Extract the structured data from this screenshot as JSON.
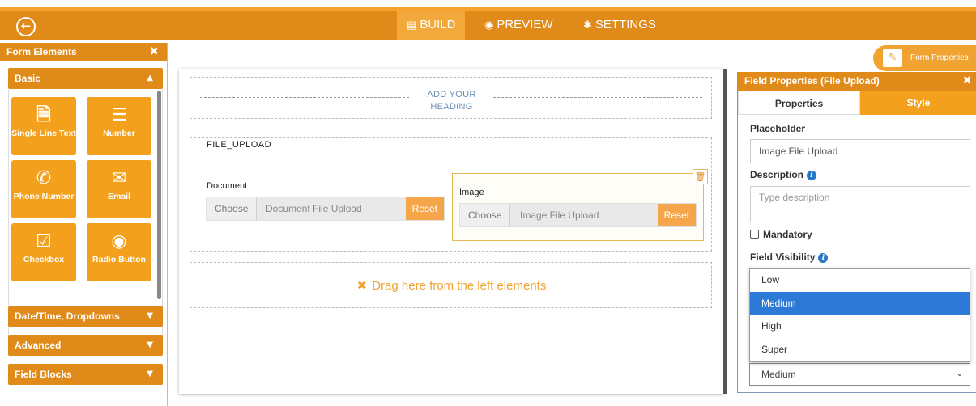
{
  "topbar": {
    "back_icon": "arrow-left-circle-icon",
    "tabs": [
      {
        "label": "BUILD",
        "icon": "form-icon",
        "active": true
      },
      {
        "label": "PREVIEW",
        "icon": "eye-icon",
        "active": false
      },
      {
        "label": "SETTINGS",
        "icon": "gear-icon",
        "active": false
      }
    ]
  },
  "left_panel": {
    "title": "Form Elements",
    "sections": {
      "basic": "Basic",
      "datetime": "Date/Time, Dropdowns",
      "advanced": "Advanced",
      "field_blocks": "Field Blocks"
    },
    "tiles": [
      {
        "label": "Single Line Text",
        "icon": "document-icon"
      },
      {
        "label": "Number",
        "icon": "numbered-list-icon"
      },
      {
        "label": "Phone Number",
        "icon": "phone-icon"
      },
      {
        "label": "Email",
        "icon": "envelope-icon"
      },
      {
        "label": "Checkbox",
        "icon": "checkbox-icon"
      },
      {
        "label": "Radio Button",
        "icon": "radio-icon"
      }
    ]
  },
  "canvas": {
    "heading_line1": "ADD YOUR",
    "heading_line2": "HEADING",
    "upload_title": "FILE_UPLOAD",
    "document": {
      "label": "Document",
      "choose": "Choose",
      "placeholder": "Document File Upload",
      "reset": "Reset"
    },
    "image": {
      "label": "Image",
      "choose": "Choose",
      "placeholder": "Image File Upload",
      "reset": "Reset"
    },
    "drop_text": "Drag here from the left elements"
  },
  "right_panel": {
    "form_props_btn": "Form Properties",
    "title": "Field Properties (File Upload)",
    "tabs": {
      "properties": "Properties",
      "style": "Style"
    },
    "placeholder_label": "Placeholder",
    "placeholder_value": "Image File Upload",
    "description_label": "Description",
    "description_placeholder": "Type description",
    "mandatory_label": "Mandatory",
    "visibility_label": "Field Visibility",
    "visibility_options": [
      "Low",
      "Medium",
      "High",
      "Super"
    ],
    "visibility_selected": "Medium"
  },
  "colors": {
    "primary": "#e08a1a",
    "accent": "#f3a01c",
    "selected": "#2c79d8"
  }
}
